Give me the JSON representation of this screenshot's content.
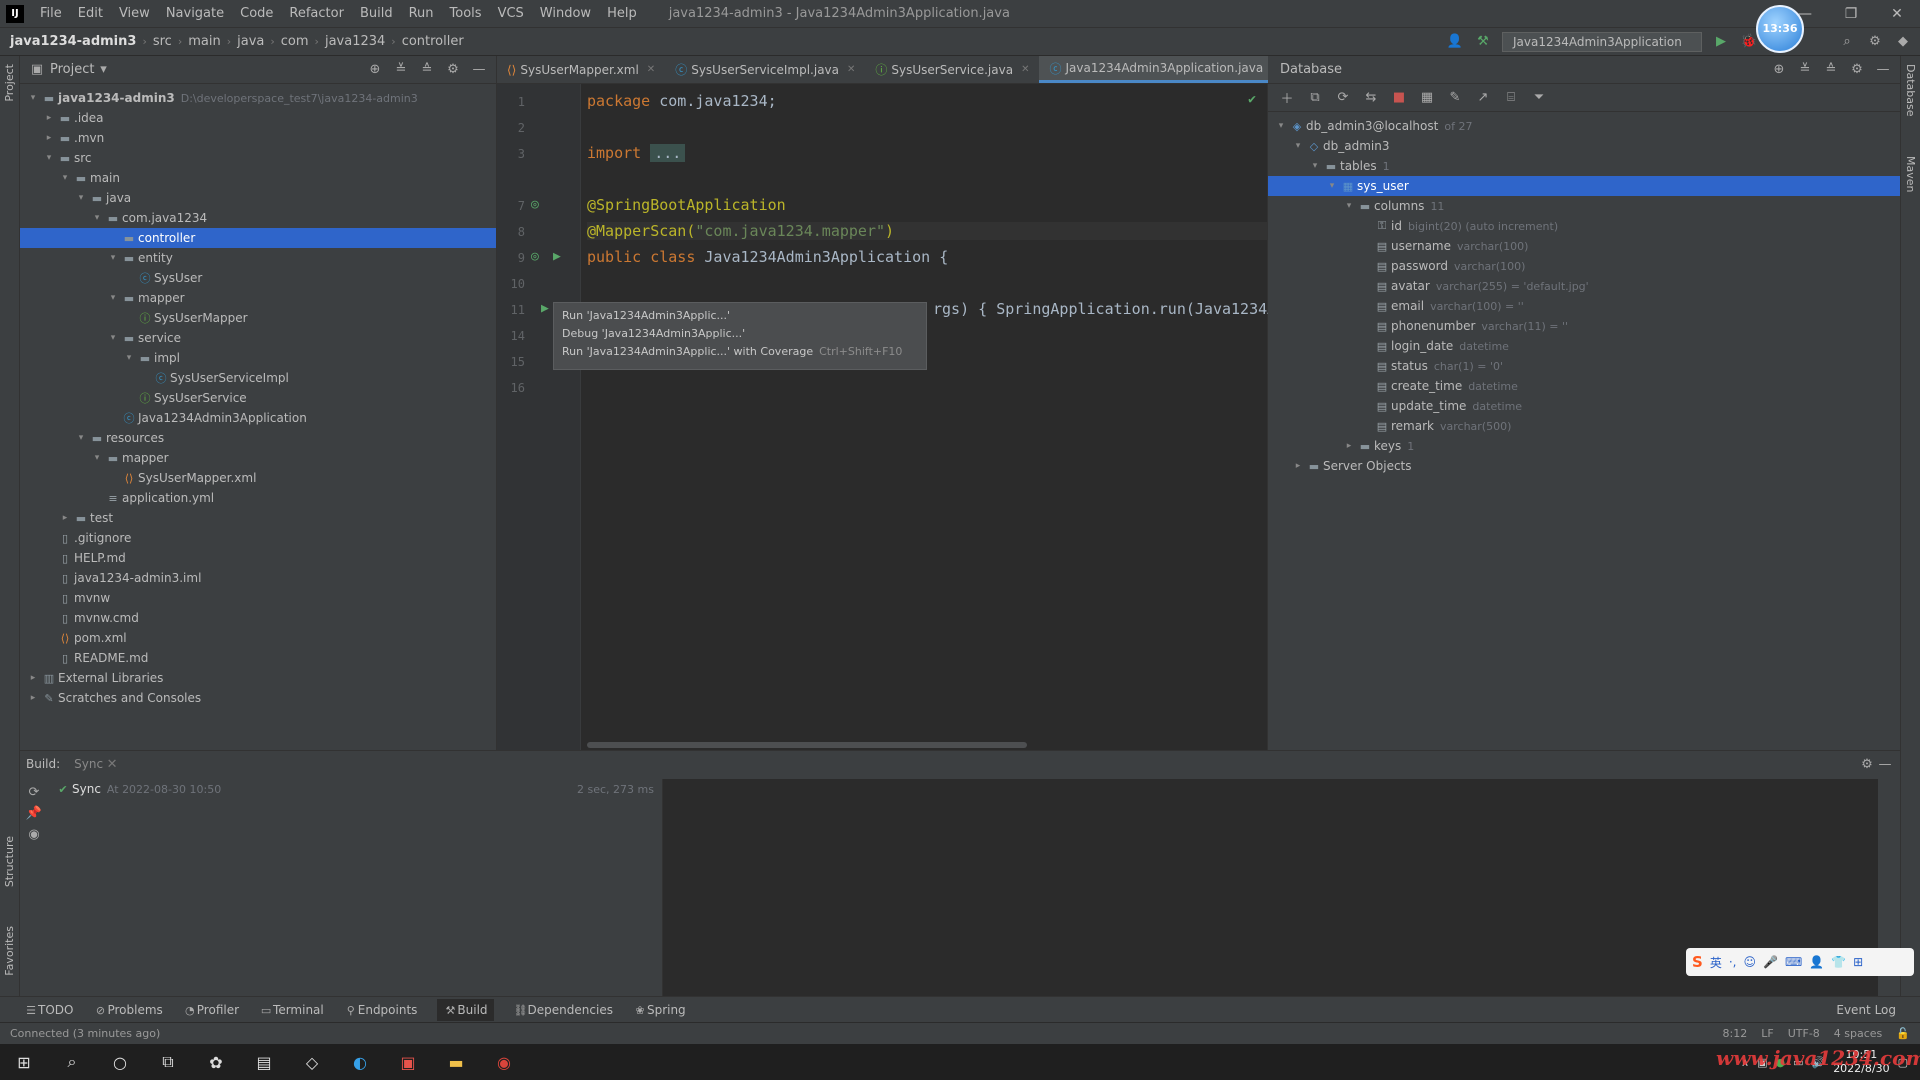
{
  "menubar": {
    "items": [
      "File",
      "Edit",
      "View",
      "Navigate",
      "Code",
      "Refactor",
      "Build",
      "Run",
      "Tools",
      "VCS",
      "Window",
      "Help"
    ],
    "window_title": "java1234-admin3 - Java1234Admin3Application.java"
  },
  "navbar": {
    "crumbs": [
      "java1234-admin3",
      "src",
      "main",
      "java",
      "com",
      "java1234",
      "controller"
    ],
    "run_config": "Java1234Admin3Application"
  },
  "avatar": {
    "text": "13:36"
  },
  "left_strip": {
    "tabs": [
      "Project",
      "Structure",
      "Favorites"
    ]
  },
  "right_strip": {
    "tabs": [
      "Database",
      "Maven"
    ]
  },
  "project": {
    "title": "Project",
    "tree": [
      {
        "label": "java1234-admin3",
        "hint": "D:\\developerspace_test7\\java1234-admin3",
        "icon": "folder-icon",
        "depth": 0,
        "arrow": "▾",
        "bold": true
      },
      {
        "label": ".idea",
        "icon": "folder-icon",
        "depth": 1,
        "arrow": "▸"
      },
      {
        "label": ".mvn",
        "icon": "folder-icon",
        "depth": 1,
        "arrow": "▸"
      },
      {
        "label": "src",
        "icon": "folder-icon",
        "depth": 1,
        "arrow": "▾"
      },
      {
        "label": "main",
        "icon": "folder-icon",
        "depth": 2,
        "arrow": "▾"
      },
      {
        "label": "java",
        "icon": "folder-icon",
        "depth": 3,
        "arrow": "▾"
      },
      {
        "label": "com.java1234",
        "icon": "folder-icon",
        "depth": 4,
        "arrow": "▾"
      },
      {
        "label": "controller",
        "icon": "folder-icon",
        "depth": 5,
        "arrow": "",
        "selected": true
      },
      {
        "label": "entity",
        "icon": "folder-icon",
        "depth": 5,
        "arrow": "▾"
      },
      {
        "label": "SysUser",
        "icon": "class-icon",
        "depth": 6,
        "arrow": ""
      },
      {
        "label": "mapper",
        "icon": "folder-icon",
        "depth": 5,
        "arrow": "▾"
      },
      {
        "label": "SysUserMapper",
        "icon": "interface-icon",
        "depth": 6,
        "arrow": ""
      },
      {
        "label": "service",
        "icon": "folder-icon",
        "depth": 5,
        "arrow": "▾"
      },
      {
        "label": "impl",
        "icon": "folder-icon",
        "depth": 6,
        "arrow": "▾"
      },
      {
        "label": "SysUserServiceImpl",
        "icon": "class-icon",
        "depth": 7,
        "arrow": ""
      },
      {
        "label": "SysUserService",
        "icon": "interface-icon",
        "depth": 6,
        "arrow": ""
      },
      {
        "label": "Java1234Admin3Application",
        "icon": "spring-class-icon",
        "depth": 5,
        "arrow": ""
      },
      {
        "label": "resources",
        "icon": "folder-icon",
        "depth": 3,
        "arrow": "▾"
      },
      {
        "label": "mapper",
        "icon": "folder-icon",
        "depth": 4,
        "arrow": "▾"
      },
      {
        "label": "SysUserMapper.xml",
        "icon": "xml-icon",
        "depth": 5,
        "arrow": ""
      },
      {
        "label": "application.yml",
        "icon": "yml-icon",
        "depth": 4,
        "arrow": ""
      },
      {
        "label": "test",
        "icon": "folder-icon",
        "depth": 2,
        "arrow": "▸"
      },
      {
        "label": ".gitignore",
        "icon": "file-icon",
        "depth": 1,
        "arrow": ""
      },
      {
        "label": "HELP.md",
        "icon": "file-icon",
        "depth": 1,
        "arrow": ""
      },
      {
        "label": "java1234-admin3.iml",
        "icon": "file-icon",
        "depth": 1,
        "arrow": ""
      },
      {
        "label": "mvnw",
        "icon": "file-icon",
        "depth": 1,
        "arrow": ""
      },
      {
        "label": "mvnw.cmd",
        "icon": "file-icon",
        "depth": 1,
        "arrow": ""
      },
      {
        "label": "pom.xml",
        "icon": "xml-icon",
        "depth": 1,
        "arrow": ""
      },
      {
        "label": "README.md",
        "icon": "file-icon",
        "depth": 1,
        "arrow": ""
      },
      {
        "label": "External Libraries",
        "icon": "library-icon",
        "depth": 0,
        "arrow": "▸"
      },
      {
        "label": "Scratches and Consoles",
        "icon": "scratch-icon",
        "depth": 0,
        "arrow": "▸"
      }
    ]
  },
  "editor": {
    "tabs": [
      {
        "label": "SysUserMapper.xml",
        "icon": "xml-icon",
        "active": false
      },
      {
        "label": "SysUserServiceImpl.java",
        "icon": "class-icon",
        "active": false
      },
      {
        "label": "SysUserService.java",
        "icon": "interface-icon",
        "active": false
      },
      {
        "label": "Java1234Admin3Application.java",
        "icon": "spring-class-icon",
        "active": true
      }
    ],
    "line_numbers": [
      "1",
      "2",
      "3",
      "7",
      "8",
      "9",
      "10",
      "11",
      "14",
      "15",
      "16"
    ],
    "code": {
      "l1_kw": "package",
      "l1_rest": " com.java1234;",
      "l3_kw": "import",
      "l3_fold": "...",
      "l7_ann": "@SpringBootApplication",
      "l8_ann": "@MapperScan(",
      "l8_str": "\"com.java1234.mapper\"",
      "l8_close": ")",
      "l9_kw": "public class",
      "l9_rest": " Java1234Admin3Application {",
      "l11_rest": "rgs) { SpringApplication.run(Java1234A",
      "l15": "}"
    },
    "popup": {
      "run": "Run 'Java1234Admin3Applic...'",
      "debug": "Debug 'Java1234Admin3Applic...'",
      "coverage": "Run 'Java1234Admin3Applic...' with Coverage",
      "coverage_shortcut": "Ctrl+Shift+F10"
    }
  },
  "database": {
    "title": "Database",
    "tree": [
      {
        "label": "db_admin3@localhost",
        "hint": "of 27",
        "icon": "datasource-icon",
        "depth": 0,
        "arrow": "▾"
      },
      {
        "label": "db_admin3",
        "hint": "",
        "icon": "schema-icon",
        "depth": 1,
        "arrow": "▾"
      },
      {
        "label": "tables",
        "hint": "1",
        "icon": "folder-icon",
        "depth": 2,
        "arrow": "▾"
      },
      {
        "label": "sys_user",
        "hint": "",
        "icon": "table-icon",
        "depth": 3,
        "arrow": "▾",
        "selected": true
      },
      {
        "label": "columns",
        "hint": "11",
        "icon": "folder-icon",
        "depth": 4,
        "arrow": "▾"
      },
      {
        "label": "id",
        "hint": "bigint(20) (auto increment)",
        "icon": "key-column-icon",
        "depth": 5,
        "arrow": ""
      },
      {
        "label": "username",
        "hint": "varchar(100)",
        "icon": "column-icon",
        "depth": 5,
        "arrow": ""
      },
      {
        "label": "password",
        "hint": "varchar(100)",
        "icon": "column-icon",
        "depth": 5,
        "arrow": ""
      },
      {
        "label": "avatar",
        "hint": "varchar(255) = 'default.jpg'",
        "icon": "column-icon",
        "depth": 5,
        "arrow": ""
      },
      {
        "label": "email",
        "hint": "varchar(100) = ''",
        "icon": "column-icon",
        "depth": 5,
        "arrow": ""
      },
      {
        "label": "phonenumber",
        "hint": "varchar(11) = ''",
        "icon": "column-icon",
        "depth": 5,
        "arrow": ""
      },
      {
        "label": "login_date",
        "hint": "datetime",
        "icon": "column-icon",
        "depth": 5,
        "arrow": ""
      },
      {
        "label": "status",
        "hint": "char(1) = '0'",
        "icon": "column-icon",
        "depth": 5,
        "arrow": ""
      },
      {
        "label": "create_time",
        "hint": "datetime",
        "icon": "column-icon",
        "depth": 5,
        "arrow": ""
      },
      {
        "label": "update_time",
        "hint": "datetime",
        "icon": "column-icon",
        "depth": 5,
        "arrow": ""
      },
      {
        "label": "remark",
        "hint": "varchar(500)",
        "icon": "column-icon",
        "depth": 5,
        "arrow": ""
      },
      {
        "label": "keys",
        "hint": "1",
        "icon": "folder-icon",
        "depth": 4,
        "arrow": "▸"
      },
      {
        "label": "Server Objects",
        "hint": "",
        "icon": "folder-icon",
        "depth": 1,
        "arrow": "▸"
      }
    ]
  },
  "build": {
    "tab_build": "Build:",
    "tab_sync": "Sync",
    "row_label": "Sync",
    "row_time": "At 2022-08-30 10:50",
    "row_duration": "2 sec, 273 ms"
  },
  "toolwindows": [
    {
      "label": "TODO",
      "icon": "list-icon"
    },
    {
      "label": "Problems",
      "icon": "problems-icon"
    },
    {
      "label": "Profiler",
      "icon": "profiler-icon"
    },
    {
      "label": "Terminal",
      "icon": "terminal-icon"
    },
    {
      "label": "Endpoints",
      "icon": "endpoints-icon"
    },
    {
      "label": "Build",
      "icon": "hammer-icon",
      "active": true
    },
    {
      "label": "Dependencies",
      "icon": "dependencies-icon"
    },
    {
      "label": "Spring",
      "icon": "spring-icon"
    }
  ],
  "event_log": "Event Log",
  "status": {
    "left": "Connected (3 minutes ago)",
    "pos": "8:12",
    "lf": "LF",
    "enc": "UTF-8",
    "indent": "4 spaces"
  },
  "taskbar": {
    "time": "10:51",
    "date": "2022/8/30",
    "ime_lang": "英"
  },
  "watermark": "www.java1234.com",
  "colors": {
    "accent": "#2f65ca",
    "tab_underline": "#4a88c7",
    "run_green": "#59a869"
  }
}
